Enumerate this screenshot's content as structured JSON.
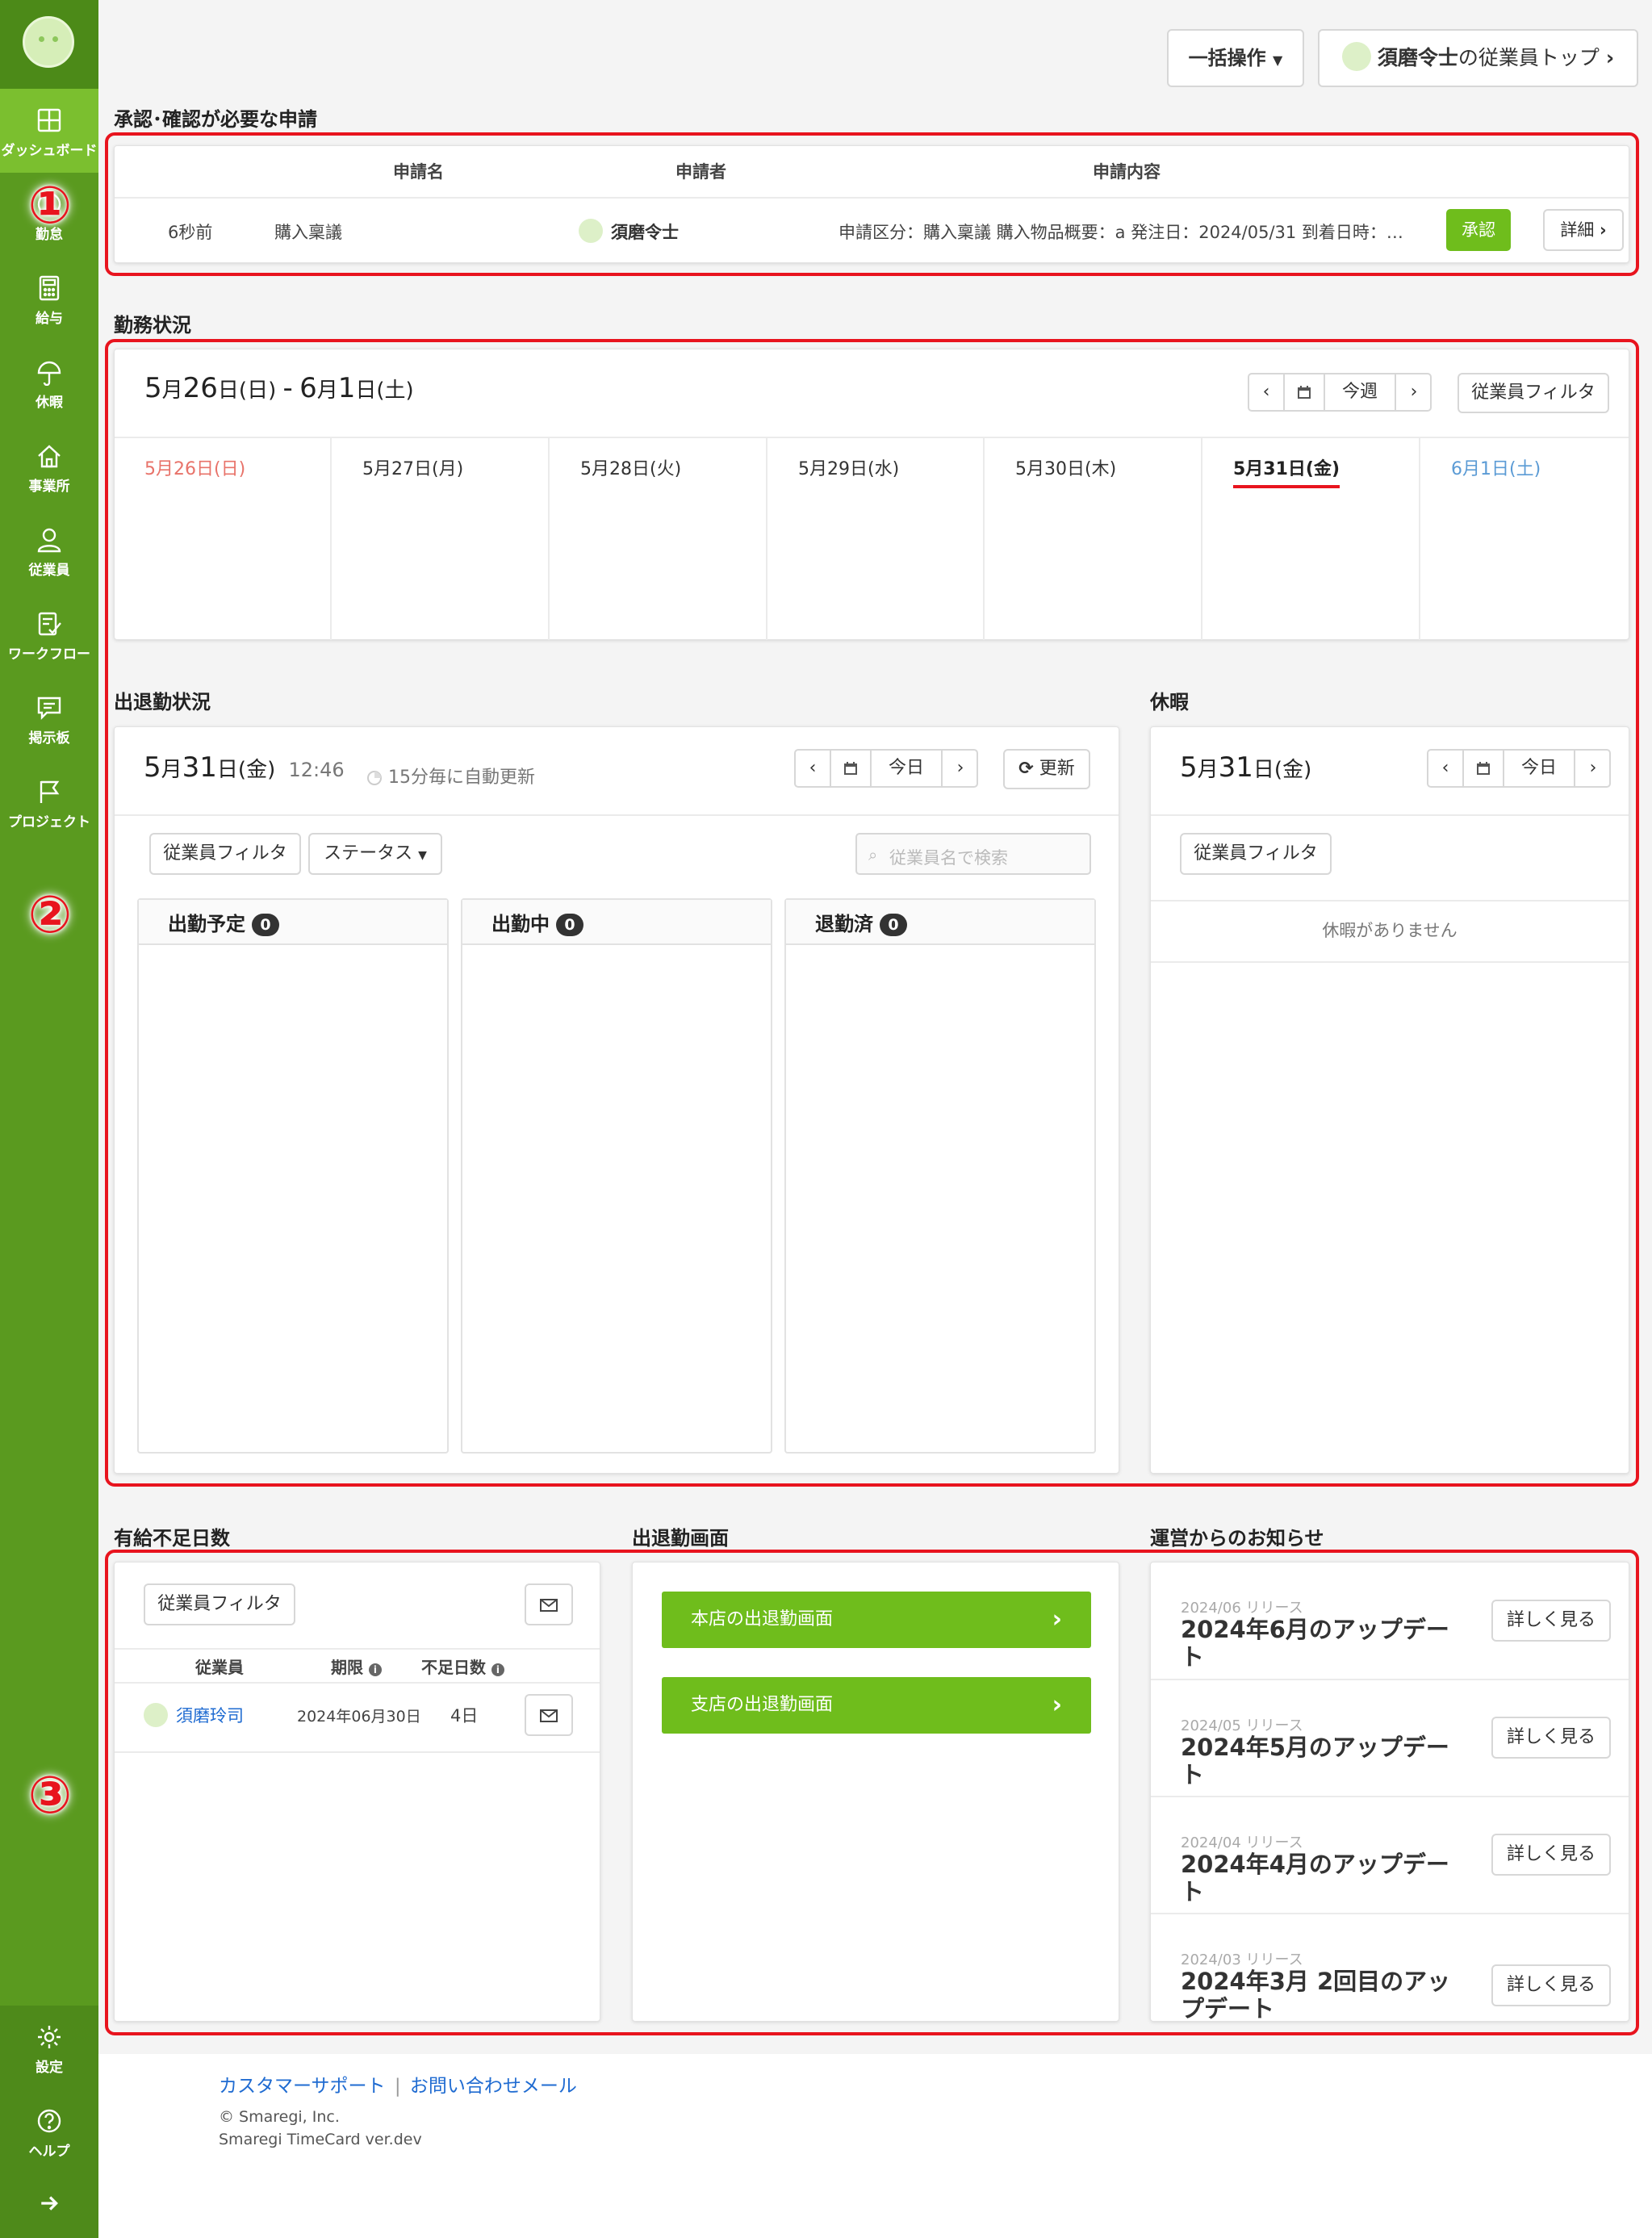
{
  "sidebar": {
    "items": [
      {
        "label": "ダッシュボード",
        "icon": "dashboard-icon"
      },
      {
        "label": "勤怠",
        "icon": "clock-icon"
      },
      {
        "label": "給与",
        "icon": "calculator-icon"
      },
      {
        "label": "休暇",
        "icon": "umbrella-icon"
      },
      {
        "label": "事業所",
        "icon": "home-icon"
      },
      {
        "label": "従業員",
        "icon": "user-icon"
      },
      {
        "label": "ワークフロー",
        "icon": "workflow-icon"
      },
      {
        "label": "掲示板",
        "icon": "chat-icon"
      },
      {
        "label": "プロジェクト",
        "icon": "flag-icon"
      }
    ],
    "settings_label": "設定",
    "help_label": "ヘルプ"
  },
  "annotations": {
    "one": "①",
    "two": "②",
    "three": "③"
  },
  "header": {
    "bulk_label": "一括操作",
    "user_name": "須磨令士",
    "employee_top_label": "の従業員トップ"
  },
  "approvals": {
    "title": "承認･確認が必要な申請",
    "col_name": "申請名",
    "col_applicant": "申請者",
    "col_content": "申請内容",
    "row": {
      "time": "6秒前",
      "name": "購入稟議",
      "applicant": "須磨令士",
      "content": "申請区分：購入稟議 購入物品概要：a 発注日：2024/05/31 到着日時：…",
      "approve": "承認",
      "detail": "詳細"
    }
  },
  "work_status": {
    "title": "勤務状況",
    "range": {
      "m1": "5",
      "d1": "26",
      "w1": "日",
      "m2": "6",
      "d2": "1",
      "w2": "土"
    },
    "this_week": "今週",
    "filter": "従業員フィルタ",
    "days": [
      "5月26日(日)",
      "5月27日(月)",
      "5月28日(火)",
      "5月29日(水)",
      "5月30日(木)",
      "5月31日(金)",
      "6月1日(土)"
    ]
  },
  "attendance": {
    "title": "出退勤状況",
    "date": {
      "m": "5",
      "d": "31",
      "w": "金"
    },
    "time": "12:46",
    "auto_update": "15分毎に自動更新",
    "today": "今日",
    "refresh": "更新",
    "filter": "従業員フィルタ",
    "status": "ステータス",
    "search_placeholder": "従業員名で検索",
    "columns": [
      {
        "title": "出勤予定",
        "count": "0"
      },
      {
        "title": "出勤中",
        "count": "0"
      },
      {
        "title": "退勤済",
        "count": "0"
      }
    ]
  },
  "leave": {
    "title": "休暇",
    "date": {
      "m": "5",
      "d": "31",
      "w": "金"
    },
    "today": "今日",
    "filter": "従業員フィルタ",
    "empty": "休暇がありません"
  },
  "paid_leave": {
    "title": "有給不足日数",
    "filter": "従業員フィルタ",
    "col_employee": "従業員",
    "col_deadline": "期限",
    "col_short": "不足日数",
    "row": {
      "name": "須磨玲司",
      "deadline": "2024年06月30日",
      "days": "4日"
    }
  },
  "clock_screen": {
    "title": "出退勤画面",
    "buttons": [
      "本店の出退勤画面",
      "支店の出退勤画面"
    ]
  },
  "news": {
    "title": "運営からのお知らせ",
    "items": [
      {
        "date": "2024/06 リリース",
        "title": "2024年6月のアップデート",
        "more": "詳しく見る"
      },
      {
        "date": "2024/05 リリース",
        "title": "2024年5月のアップデート",
        "more": "詳しく見る"
      },
      {
        "date": "2024/04 リリース",
        "title": "2024年4月のアップデート",
        "more": "詳しく見る"
      },
      {
        "date": "2024/03 リリース",
        "title": "2024年3月 2回目のアップデート",
        "more": "詳しく見る"
      }
    ]
  },
  "footer": {
    "support": "カスタマーサポート",
    "separator": "|",
    "mail": "お問い合わせメール",
    "copyright": "© Smaregi, Inc.",
    "version": "Smaregi TimeCard ver.dev"
  },
  "colors": {
    "sidebar": "#5a9a1f",
    "accent": "#6fbd1c",
    "highlight": "#e8141e",
    "sunday": "#e8736a",
    "saturday": "#5b9bd5"
  }
}
